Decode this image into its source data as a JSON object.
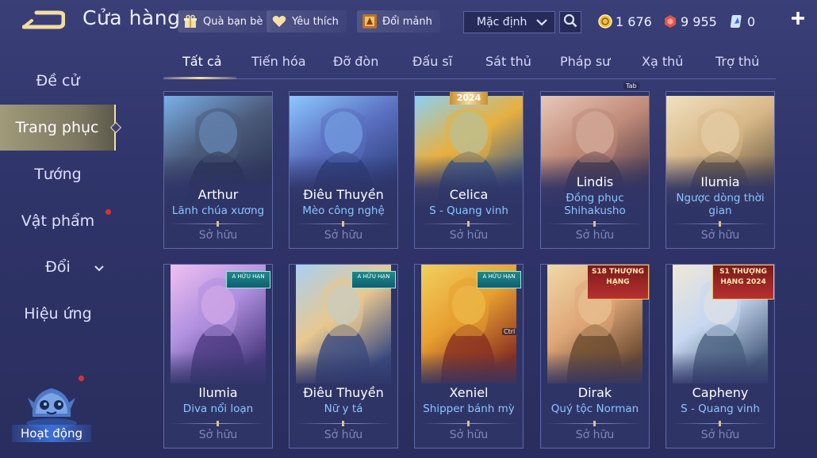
{
  "header": {
    "title": "Cửa hàng",
    "buttons": [
      {
        "label": "Quà bạn bè",
        "icon": "gift-icon"
      },
      {
        "label": "Yêu thích",
        "icon": "heart-icon"
      },
      {
        "label": "Đổi mảnh",
        "icon": "fragment-exchange-icon"
      }
    ],
    "sort_value": "Mặc định",
    "currencies": [
      {
        "value": "1 676",
        "icon": "gold-coin-icon",
        "color": "#f0c040"
      },
      {
        "value": "9 955",
        "icon": "voucher-icon",
        "color": "#e0554a"
      },
      {
        "value": "0",
        "icon": "skin-fragment-icon",
        "color": "#6ab4ff"
      }
    ]
  },
  "sidebar": {
    "items": [
      {
        "label": "Đề cử"
      },
      {
        "label": "Trang phục",
        "active": true
      },
      {
        "label": "Tướng"
      },
      {
        "label": "Vật phẩm",
        "dot": true
      },
      {
        "label": "Đổi",
        "expandable": true
      },
      {
        "label": "Hiệu ứng"
      }
    ],
    "event_label": "Hoạt động"
  },
  "tabs": [
    "Tất cả",
    "Tiến hóa",
    "Đỡ đòn",
    "Đấu sĩ",
    "Sát thủ",
    "Pháp sư",
    "Xạ thủ",
    "Trợ thủ"
  ],
  "tab_hint": "Tab",
  "card_hint": "Ctrl",
  "accent_color": "#f3dca0",
  "skin_color": "#88c7ff",
  "cards": [
    {
      "hero": "Arthur",
      "skin": "Lãnh chúa xương",
      "owned": "Sở hữu",
      "badge": "",
      "palette": [
        "#2a3350",
        "#4b5a7a",
        "#7ab0e8"
      ]
    },
    {
      "hero": "Điêu Thuyền",
      "skin": "Mèo công nghệ",
      "owned": "Sở hữu",
      "badge": "",
      "palette": [
        "#2b3f7a",
        "#5a6fc0",
        "#8cc8ff"
      ]
    },
    {
      "hero": "Celica",
      "skin": "S - Quang vinh",
      "owned": "Sở hữu",
      "badge": "2024",
      "palette": [
        "#3a5a8a",
        "#e8b040",
        "#8ad0f0"
      ]
    },
    {
      "hero": "Lindis",
      "skin": "Đồng phục Shihakusho",
      "owned": "Sở hữu",
      "badge": "",
      "palette": [
        "#4a3a4a",
        "#c08a78",
        "#e8c8b8"
      ]
    },
    {
      "hero": "Ilumia",
      "skin": "Ngược dòng thời gian",
      "owned": "Sở hữu",
      "badge": "",
      "palette": [
        "#6a5a40",
        "#d8b888",
        "#f0e0c0"
      ]
    },
    {
      "hero": "Ilumia",
      "skin": "Diva nổi loạn",
      "owned": "Sở hữu",
      "badge": "A HỮU HẠN",
      "palette": [
        "#4a3a80",
        "#b090e0",
        "#f0c0f0"
      ]
    },
    {
      "hero": "Điêu Thuyền",
      "skin": "Nữ y tá",
      "owned": "Sở hữu",
      "badge": "A HỮU HẠN",
      "palette": [
        "#3a4a80",
        "#e8c890",
        "#a8d0f0"
      ]
    },
    {
      "hero": "Xeniel",
      "skin": "Shipper bánh mỳ",
      "owned": "Sở hữu",
      "badge": "A HỮU HẠN",
      "palette": [
        "#8a3020",
        "#e8a030",
        "#f0d060"
      ]
    },
    {
      "hero": "Dirak",
      "skin": "Quý tộc Norman",
      "owned": "Sở hữu",
      "badge": "S18 THƯỢNG HẠNG",
      "palette": [
        "#6a4a30",
        "#e0a878",
        "#f0d8a8"
      ]
    },
    {
      "hero": "Capheny",
      "skin": "S - Quang vinh",
      "owned": "Sở hữu",
      "badge": "S1 THƯỢNG HẠNG 2024",
      "palette": [
        "#4a6080",
        "#c8d8f0",
        "#f0e8d8"
      ]
    }
  ]
}
